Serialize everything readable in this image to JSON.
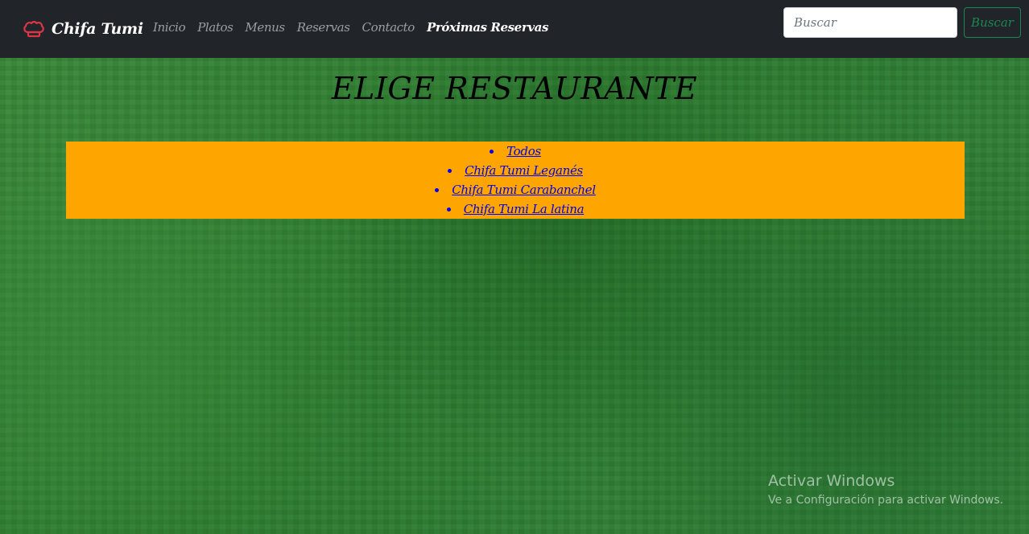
{
  "navbar": {
    "brand": "Chifa Tumi",
    "brand_icon": "chef-hat-icon",
    "brand_icon_color": "#dc3545",
    "links": [
      {
        "label": "Inicio",
        "active": false
      },
      {
        "label": "Platos",
        "active": false
      },
      {
        "label": "Menus",
        "active": false
      },
      {
        "label": "Reservas",
        "active": false
      },
      {
        "label": "Contacto",
        "active": false
      },
      {
        "label": "Próximas Reservas",
        "active": true
      }
    ],
    "search": {
      "placeholder": "Buscar",
      "value": "",
      "button_label": "Buscar"
    }
  },
  "main": {
    "title": "ELIGE RESTAURANTE",
    "restaurants": [
      "Todos",
      "Chifa Tumi Leganés",
      "Chifa Tumi Carabanchel",
      "Chifa Tumi La latina"
    ]
  },
  "watermark": {
    "title": "Activar Windows",
    "subtitle": "Ve a Configuración para activar Windows."
  },
  "colors": {
    "navbar_bg": "#212529",
    "list_bg": "#ffa500",
    "link": "#0000ee",
    "search_button": "#198754",
    "page_bg": "#2f7d32"
  }
}
